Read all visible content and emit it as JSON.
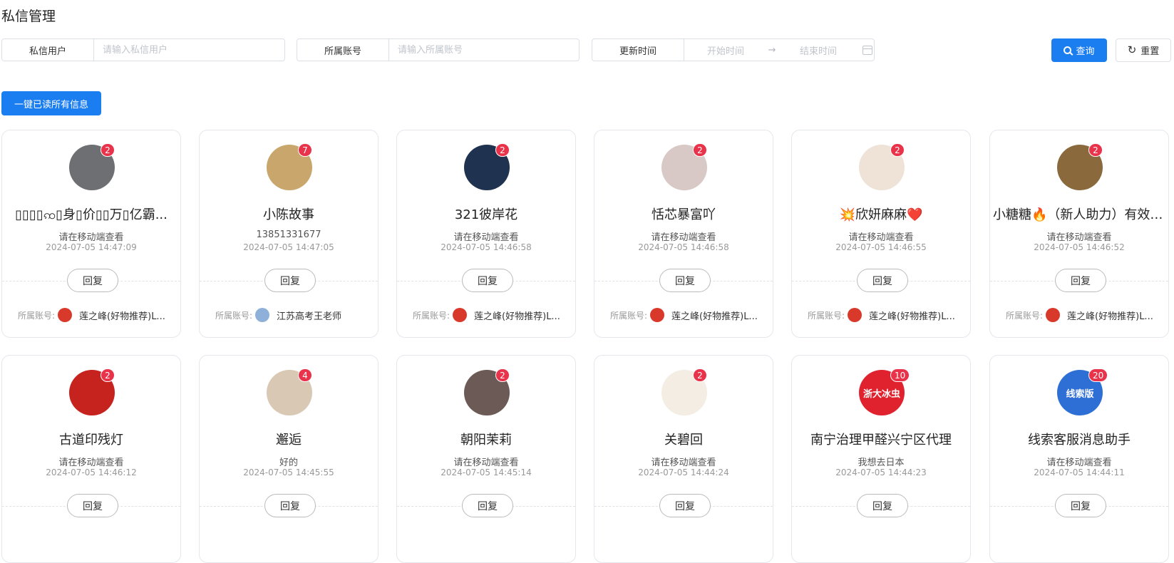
{
  "page": {
    "title": "私信管理"
  },
  "filters": {
    "user_label": "私信用户",
    "user_placeholder": "请输入私信用户",
    "account_label": "所属账号",
    "account_placeholder": "请输入所属账号",
    "time_label": "更新时间",
    "start_placeholder": "开始时间",
    "end_placeholder": "结束时间",
    "query_label": "查询",
    "reset_label": "重置"
  },
  "actions": {
    "read_all": "一键已读所有信息"
  },
  "card_labels": {
    "reply": "回复",
    "account_prefix": "所属账号:"
  },
  "colors": {
    "primary": "#1a7df0",
    "badge": "#e8334a"
  },
  "cards": [
    {
      "name": "▯▯▯▯ꩡ▯身▯价▯▯万▯亿霸...",
      "message": "请在移动端查看",
      "time": "2024-07-05 14:47:09",
      "unread": "2",
      "account": "莲之峰(好物推荐)L...",
      "avatar_color": "#6d6f72",
      "account_avatar_color": "#d8392b"
    },
    {
      "name": "小陈故事",
      "message": "13851331677",
      "time": "2024-07-05 14:47:05",
      "unread": "7",
      "account": "江苏高考王老师",
      "avatar_color": "#c9a66b",
      "account_avatar_color": "#8fb1d9"
    },
    {
      "name": "321彼岸花",
      "message": "请在移动端查看",
      "time": "2024-07-05 14:46:58",
      "unread": "2",
      "account": "莲之峰(好物推荐)L...",
      "avatar_color": "#1f3350",
      "account_avatar_color": "#d8392b"
    },
    {
      "name": "恬芯暴富吖",
      "message": "请在移动端查看",
      "time": "2024-07-05 14:46:58",
      "unread": "2",
      "account": "莲之峰(好物推荐)L...",
      "avatar_color": "#d8c8c6",
      "account_avatar_color": "#d8392b"
    },
    {
      "name": "💥欣妍麻麻❤️",
      "message": "请在移动端查看",
      "time": "2024-07-05 14:46:55",
      "unread": "2",
      "account": "莲之峰(好物推荐)L...",
      "avatar_color": "#efe2d6",
      "account_avatar_color": "#d8392b"
    },
    {
      "name": "小糖糖🔥（新人助力）有效粉...",
      "message": "请在移动端查看",
      "time": "2024-07-05 14:46:52",
      "unread": "2",
      "account": "莲之峰(好物推荐)L...",
      "avatar_color": "#8a6a3c",
      "account_avatar_color": "#d8392b"
    },
    {
      "name": "古道印残灯",
      "message": "请在移动端查看",
      "time": "2024-07-05 14:46:12",
      "unread": "2",
      "avatar_color": "#c6231e"
    },
    {
      "name": "邂逅",
      "message": "好的",
      "time": "2024-07-05 14:45:55",
      "unread": "4",
      "avatar_color": "#d9c9b4"
    },
    {
      "name": "朝阳茉莉",
      "message": "请在移动端查看",
      "time": "2024-07-05 14:45:14",
      "unread": "2",
      "avatar_color": "#6b5a55"
    },
    {
      "name": "关碧回",
      "message": "请在移动端查看",
      "time": "2024-07-05 14:44:24",
      "unread": "2",
      "avatar_color": "#f3ede4"
    },
    {
      "name": "南宁治理甲醛兴宁区代理",
      "message": "我想去日本",
      "time": "2024-07-05 14:44:23",
      "unread": "10",
      "avatar_color": "#e0222e",
      "avatar_text": "浙大冰虫"
    },
    {
      "name": "线索客服消息助手",
      "message": "请在移动端查看",
      "time": "2024-07-05 14:44:11",
      "unread": "20",
      "avatar_color": "#2e6fd6",
      "avatar_text": "线索版"
    }
  ]
}
